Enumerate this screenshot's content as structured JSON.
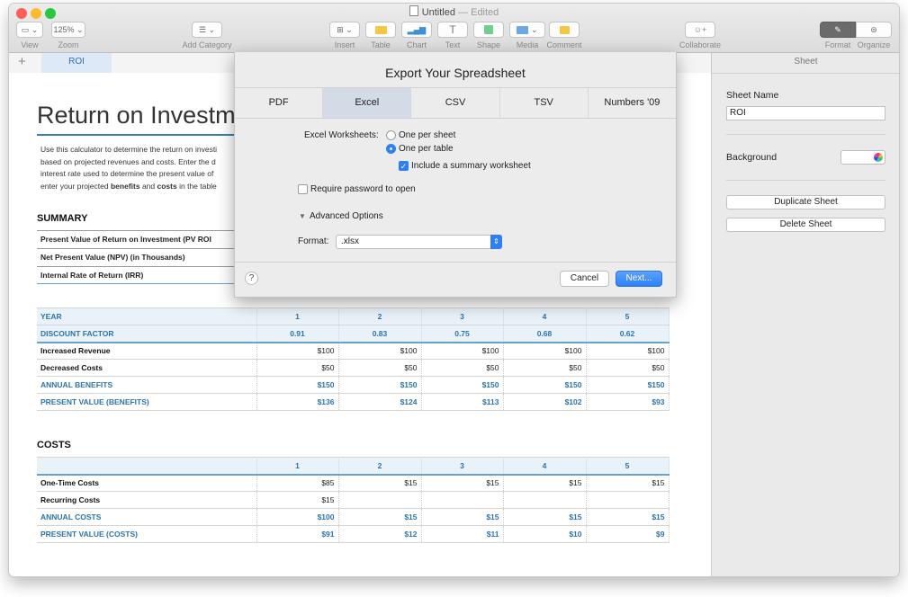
{
  "window": {
    "title": "Untitled",
    "edited": "— Edited",
    "traffic_colors": [
      "#fd5f57",
      "#febc2e",
      "#28c840"
    ]
  },
  "toolbar": {
    "view_label": "View",
    "zoom_value": "125%",
    "zoom_label": "Zoom",
    "add_category_label": "Add Category",
    "insert_label": "Insert",
    "table_label": "Table",
    "chart_label": "Chart",
    "text_label": "Text",
    "shape_label": "Shape",
    "media_label": "Media",
    "comment_label": "Comment",
    "collaborate_label": "Collaborate",
    "format_label": "Format",
    "organize_label": "Organize"
  },
  "tabs": {
    "add": "+",
    "sheet_name": "ROI"
  },
  "document": {
    "title": "Return on Investme",
    "description_lines": [
      "Use this calculator to determine the return on investi",
      "based on projected revenues and costs. Enter the d",
      "interest rate used to determine the present value of",
      "enter your projected"
    ],
    "desc_bold_1": "benefits",
    "desc_and": "and",
    "desc_bold_2": "costs",
    "desc_tail": "in the table",
    "summary_heading": "SUMMARY",
    "summary_rows": [
      "Present Value of Return on Investment (PV ROI",
      "Net Present Value (NPV) (in Thousands)",
      "Internal Rate of Return (IRR)"
    ],
    "benefits_table": {
      "header": [
        "YEAR",
        "1",
        "2",
        "3",
        "4",
        "5"
      ],
      "discount": [
        "DISCOUNT FACTOR",
        "0.91",
        "0.83",
        "0.75",
        "0.68",
        "0.62"
      ],
      "rows": [
        [
          "Increased Revenue",
          "$100",
          "$100",
          "$100",
          "$100",
          "$100"
        ],
        [
          "Decreased Costs",
          "$50",
          "$50",
          "$50",
          "$50",
          "$50"
        ]
      ],
      "annual": [
        "ANNUAL BENEFITS",
        "$150",
        "$150",
        "$150",
        "$150",
        "$150"
      ],
      "present": [
        "PRESENT VALUE (BENEFITS)",
        "$136",
        "$124",
        "$113",
        "$102",
        "$93"
      ]
    },
    "costs_heading": "COSTS",
    "costs_table": {
      "header": [
        "",
        "1",
        "2",
        "3",
        "4",
        "5"
      ],
      "rows": [
        [
          "One-Time Costs",
          "$85",
          "$15",
          "$15",
          "$15",
          "$15"
        ],
        [
          "Recurring Costs",
          "$15",
          "",
          "",
          "",
          ""
        ]
      ],
      "annual": [
        "ANNUAL COSTS",
        "$100",
        "$15",
        "$15",
        "$15",
        "$15"
      ],
      "present": [
        "PRESENT VALUE (COSTS)",
        "$91",
        "$12",
        "$11",
        "$10",
        "$9"
      ]
    }
  },
  "inspector": {
    "header": "Sheet",
    "sheet_name_label": "Sheet Name",
    "sheet_name_value": "ROI",
    "background_label": "Background",
    "duplicate_label": "Duplicate Sheet",
    "delete_label": "Delete Sheet"
  },
  "dialog": {
    "title": "Export Your Spreadsheet",
    "formats": [
      "PDF",
      "Excel",
      "CSV",
      "TSV",
      "Numbers '09"
    ],
    "worksheets_label": "Excel Worksheets:",
    "option_one_per_sheet": "One per sheet",
    "option_one_per_table": "One per table",
    "include_summary": "Include a summary worksheet",
    "require_password": "Require password to open",
    "advanced_options": "Advanced Options",
    "format_label": "Format:",
    "format_value": ".xlsx",
    "help": "?",
    "cancel": "Cancel",
    "next": "Next..."
  },
  "colors": {
    "accent": "#2d7ff9",
    "table_blue": "#2b74a9"
  }
}
